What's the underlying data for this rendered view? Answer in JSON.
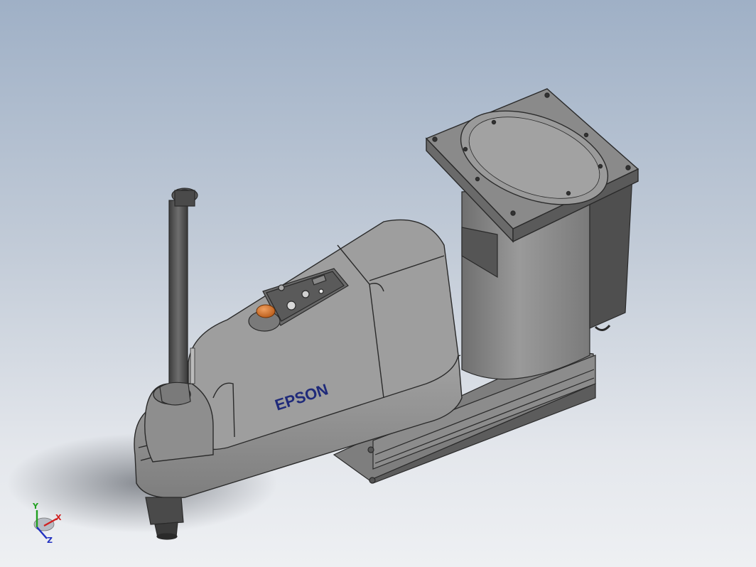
{
  "viewport": {
    "background_top": "#9fb0c6",
    "background_bottom": "#eef0f3"
  },
  "model": {
    "brand_label": "EPSON",
    "brand_color": "#1f2a7a",
    "body_color": "#8d8d8d",
    "edge_color": "#2a2a2a",
    "button_color": "#c8641e"
  },
  "triad": {
    "x_label": "X",
    "y_label": "Y",
    "z_label": "Z",
    "x_color": "#d02020",
    "y_color": "#20a020",
    "z_color": "#2030c0"
  }
}
